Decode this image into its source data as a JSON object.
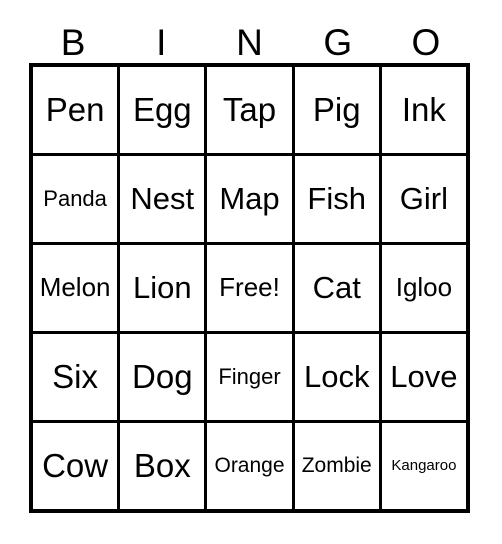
{
  "card": {
    "headers": [
      "B",
      "I",
      "N",
      "G",
      "O"
    ],
    "free_space_label": "Free!",
    "colors": {
      "background": "#ffffff",
      "text": "#000000",
      "border": "#000000"
    },
    "rows": [
      [
        {
          "label": "Pen",
          "size": "fs-xl"
        },
        {
          "label": "Egg",
          "size": "fs-xl"
        },
        {
          "label": "Tap",
          "size": "fs-xl"
        },
        {
          "label": "Pig",
          "size": "fs-xl"
        },
        {
          "label": "Ink",
          "size": "fs-xl"
        }
      ],
      [
        {
          "label": "Panda",
          "size": "fs-sm"
        },
        {
          "label": "Nest",
          "size": "fs-lg"
        },
        {
          "label": "Map",
          "size": "fs-lg"
        },
        {
          "label": "Fish",
          "size": "fs-lg"
        },
        {
          "label": "Girl",
          "size": "fs-lg"
        }
      ],
      [
        {
          "label": "Melon",
          "size": "fs-md"
        },
        {
          "label": "Lion",
          "size": "fs-lg"
        },
        {
          "label": "Free!",
          "size": "fs-md"
        },
        {
          "label": "Cat",
          "size": "fs-lg"
        },
        {
          "label": "Igloo",
          "size": "fs-md"
        }
      ],
      [
        {
          "label": "Six",
          "size": "fs-xl"
        },
        {
          "label": "Dog",
          "size": "fs-xl"
        },
        {
          "label": "Finger",
          "size": "fs-sm"
        },
        {
          "label": "Lock",
          "size": "fs-lg"
        },
        {
          "label": "Love",
          "size": "fs-lg"
        }
      ],
      [
        {
          "label": "Cow",
          "size": "fs-xl"
        },
        {
          "label": "Box",
          "size": "fs-xl"
        },
        {
          "label": "Orange",
          "size": "fs-xs"
        },
        {
          "label": "Zombie",
          "size": "fs-xs"
        },
        {
          "label": "Kangaroo",
          "size": "fs-xxs"
        }
      ]
    ]
  }
}
